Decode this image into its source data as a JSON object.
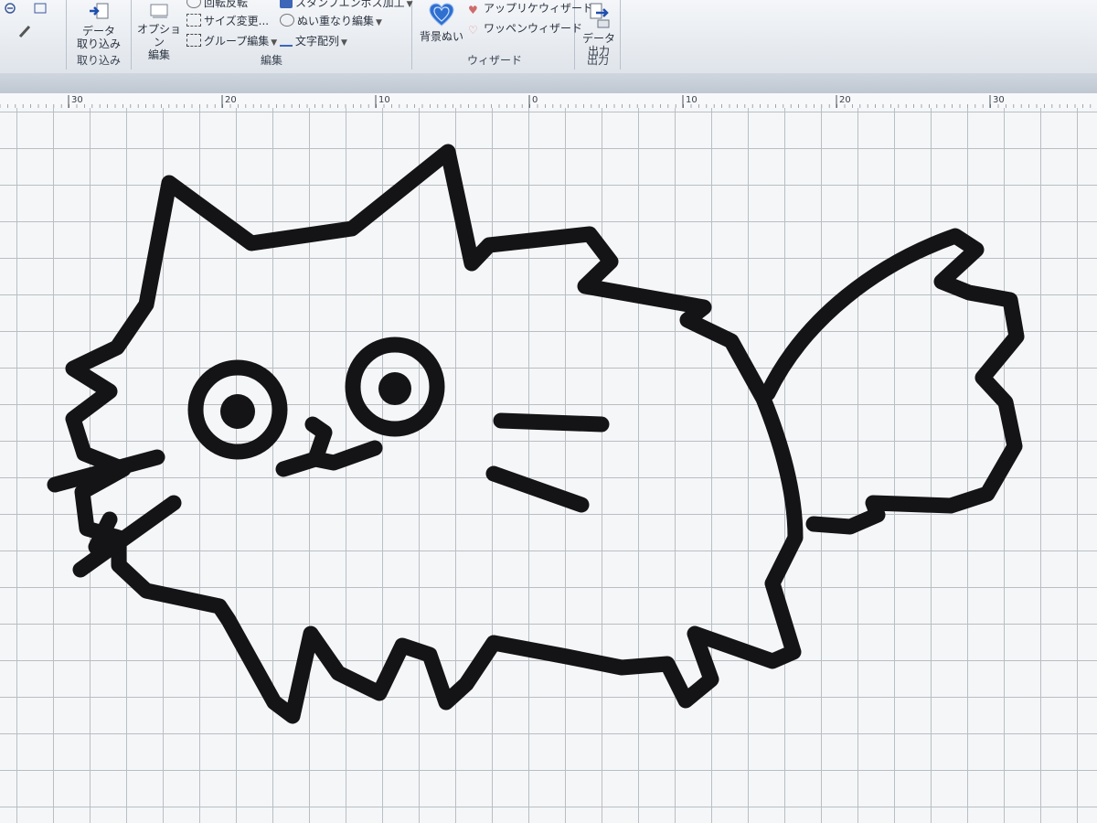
{
  "ribbon": {
    "data_group": {
      "import_button": "データ\n取り込み",
      "label": "取り込み"
    },
    "edit_group": {
      "option_edit_button": "オプション\n編集",
      "rotate_item": "回転反転",
      "resize_item": "サイズ変更...",
      "group_edit_item": "グループ編集",
      "stamp_emboss_item": "スタンプエンボス加工",
      "overlap_stitch_item": "ぬい重なり編集",
      "text_layout_item": "文字配列",
      "label": "編集"
    },
    "wizard_group": {
      "background_stitch_button": "背景ぬい",
      "applique_wizard_item": "アップリケウィザード",
      "patch_wizard_item": "ワッペンウィザード",
      "label": "ウィザード"
    },
    "output_group": {
      "data_output_button": "データ\n出力",
      "label": "出力"
    }
  },
  "ruler": {
    "ticks": [
      "30",
      "20",
      "10",
      "0",
      "10",
      "20",
      "30"
    ]
  },
  "design": {
    "stitch_color": "#141416"
  },
  "icons": {
    "import": "import-icon",
    "heart": "heart-icon",
    "output": "output-icon"
  }
}
